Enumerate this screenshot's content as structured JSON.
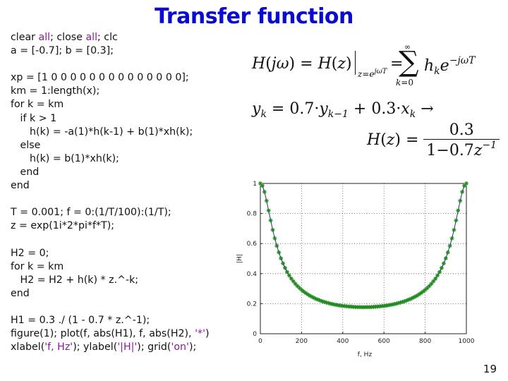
{
  "slide": {
    "title": "Transfer function",
    "page_number": "19"
  },
  "code": {
    "lines": [
      [
        {
          "t": "clear "
        },
        {
          "t": "all",
          "c": "kw"
        },
        {
          "t": "; close "
        },
        {
          "t": "all",
          "c": "kw"
        },
        {
          "t": "; clc"
        }
      ],
      [
        {
          "t": "a = [-0.7]; b = [0.3];"
        }
      ],
      [
        {
          "t": ""
        }
      ],
      [
        {
          "t": "xp = [1 0 0 0 0 0 0 0 0 0 0 0 0 0 0];"
        }
      ],
      [
        {
          "t": "km = 1:length(x);"
        }
      ],
      [
        {
          "t": "for k = km"
        }
      ],
      [
        {
          "t": "   if k > 1"
        }
      ],
      [
        {
          "t": "      h(k) = -a(1)*h(k-1) + b(1)*xh(k);"
        }
      ],
      [
        {
          "t": "   else"
        }
      ],
      [
        {
          "t": "      h(k) = b(1)*xh(k);"
        }
      ],
      [
        {
          "t": "   end"
        }
      ],
      [
        {
          "t": "end"
        }
      ],
      [
        {
          "t": ""
        }
      ],
      [
        {
          "t": "T = 0.001; f = 0:(1/T/100):(1/T);"
        }
      ],
      [
        {
          "t": "z = exp(1i*2*pi*f*T);"
        }
      ],
      [
        {
          "t": ""
        }
      ],
      [
        {
          "t": "H2 = 0;"
        }
      ],
      [
        {
          "t": "for k = km"
        }
      ],
      [
        {
          "t": "   H2 = H2 + h(k) * z.^-k;"
        }
      ],
      [
        {
          "t": "end"
        }
      ],
      [
        {
          "t": ""
        }
      ],
      [
        {
          "t": "H1 = 0.3 ./ (1 - 0.7 * z.^-1);"
        }
      ],
      [
        {
          "t": "figure(1); plot(f, abs(H1), f, abs(H2), "
        },
        {
          "t": "'*'",
          "c": "str"
        },
        {
          "t": ")"
        }
      ],
      [
        {
          "t": "xlabel("
        },
        {
          "t": "'f, Hz'",
          "c": "str"
        },
        {
          "t": "); ylabel("
        },
        {
          "t": "'|H|'",
          "c": "str"
        },
        {
          "t": "); grid("
        },
        {
          "t": "'on'",
          "c": "str"
        },
        {
          "t": ");"
        }
      ]
    ]
  },
  "equations": {
    "eq1": "H(jω) = H(z)|z=e^{jωT} = Σ_{k=0}^{∞} h_k e^{-jωT}",
    "eq2": "y_k = 0.7·y_{k-1} + 0.3·x_k →",
    "eq3": "H(z) = 0.3 / (1 − 0.7 z^{-1})",
    "eq2_coef1": "0.7",
    "eq2_coef2": "0.3",
    "eq3_num": "0.3",
    "eq3_den": "1−0.7"
  },
  "chart_data": {
    "type": "line",
    "title": "",
    "xlabel": "f, Hz",
    "ylabel": "|H|",
    "xlim": [
      0,
      1000
    ],
    "ylim": [
      0,
      1
    ],
    "xticks": [
      0,
      200,
      400,
      600,
      800,
      1000
    ],
    "yticks": [
      0,
      0.2,
      0.4,
      0.6,
      0.8,
      1
    ],
    "ytick_labels": [
      "0",
      "0.2",
      "0.4",
      "0.6",
      "0.8",
      "1"
    ],
    "grid": true,
    "legend": null,
    "x": [
      0,
      10,
      20,
      30,
      40,
      50,
      60,
      70,
      80,
      90,
      100,
      110,
      120,
      130,
      140,
      150,
      160,
      170,
      180,
      190,
      200,
      210,
      220,
      230,
      240,
      250,
      260,
      270,
      280,
      290,
      300,
      310,
      320,
      330,
      340,
      350,
      360,
      370,
      380,
      390,
      400,
      410,
      420,
      430,
      440,
      450,
      460,
      470,
      480,
      490,
      500,
      510,
      520,
      530,
      540,
      550,
      560,
      570,
      580,
      590,
      600,
      610,
      620,
      630,
      640,
      650,
      660,
      670,
      680,
      690,
      700,
      710,
      720,
      730,
      740,
      750,
      760,
      770,
      780,
      790,
      800,
      810,
      820,
      830,
      840,
      850,
      860,
      870,
      880,
      890,
      900,
      910,
      920,
      930,
      940,
      950,
      960,
      970,
      980,
      990,
      1000
    ],
    "series": [
      {
        "name": "abs(H1)",
        "style": "line",
        "color": "#2a2a9a",
        "values": [
          1.0,
          0.985,
          0.944,
          0.885,
          0.82,
          0.754,
          0.691,
          0.635,
          0.585,
          0.541,
          0.502,
          0.468,
          0.438,
          0.411,
          0.388,
          0.367,
          0.349,
          0.332,
          0.317,
          0.304,
          0.292,
          0.281,
          0.271,
          0.262,
          0.253,
          0.246,
          0.239,
          0.232,
          0.227,
          0.221,
          0.216,
          0.212,
          0.208,
          0.204,
          0.2,
          0.197,
          0.194,
          0.192,
          0.189,
          0.187,
          0.185,
          0.184,
          0.182,
          0.181,
          0.18,
          0.179,
          0.178,
          0.177,
          0.177,
          0.177,
          0.176,
          0.177,
          0.177,
          0.177,
          0.178,
          0.179,
          0.18,
          0.181,
          0.182,
          0.184,
          0.185,
          0.187,
          0.189,
          0.192,
          0.194,
          0.197,
          0.2,
          0.204,
          0.208,
          0.212,
          0.216,
          0.221,
          0.227,
          0.232,
          0.239,
          0.246,
          0.253,
          0.262,
          0.271,
          0.281,
          0.292,
          0.304,
          0.317,
          0.332,
          0.349,
          0.367,
          0.388,
          0.411,
          0.438,
          0.468,
          0.502,
          0.541,
          0.585,
          0.635,
          0.691,
          0.754,
          0.82,
          0.885,
          0.944,
          0.985,
          1.0
        ]
      },
      {
        "name": "abs(H2)",
        "style": "marker-star",
        "color": "#1f8a1f",
        "values": [
          1.0,
          0.985,
          0.944,
          0.885,
          0.82,
          0.754,
          0.691,
          0.635,
          0.585,
          0.541,
          0.502,
          0.468,
          0.438,
          0.411,
          0.388,
          0.367,
          0.349,
          0.332,
          0.317,
          0.304,
          0.292,
          0.281,
          0.271,
          0.262,
          0.253,
          0.246,
          0.239,
          0.232,
          0.227,
          0.221,
          0.216,
          0.212,
          0.208,
          0.204,
          0.2,
          0.197,
          0.194,
          0.192,
          0.189,
          0.187,
          0.185,
          0.184,
          0.182,
          0.181,
          0.18,
          0.179,
          0.178,
          0.177,
          0.177,
          0.177,
          0.176,
          0.177,
          0.177,
          0.177,
          0.178,
          0.179,
          0.18,
          0.181,
          0.182,
          0.184,
          0.185,
          0.187,
          0.189,
          0.192,
          0.194,
          0.197,
          0.2,
          0.204,
          0.208,
          0.212,
          0.216,
          0.221,
          0.227,
          0.232,
          0.239,
          0.246,
          0.253,
          0.262,
          0.271,
          0.281,
          0.292,
          0.304,
          0.317,
          0.332,
          0.349,
          0.367,
          0.388,
          0.411,
          0.438,
          0.468,
          0.502,
          0.541,
          0.585,
          0.635,
          0.691,
          0.754,
          0.82,
          0.885,
          0.944,
          0.985,
          1.0
        ]
      }
    ]
  }
}
